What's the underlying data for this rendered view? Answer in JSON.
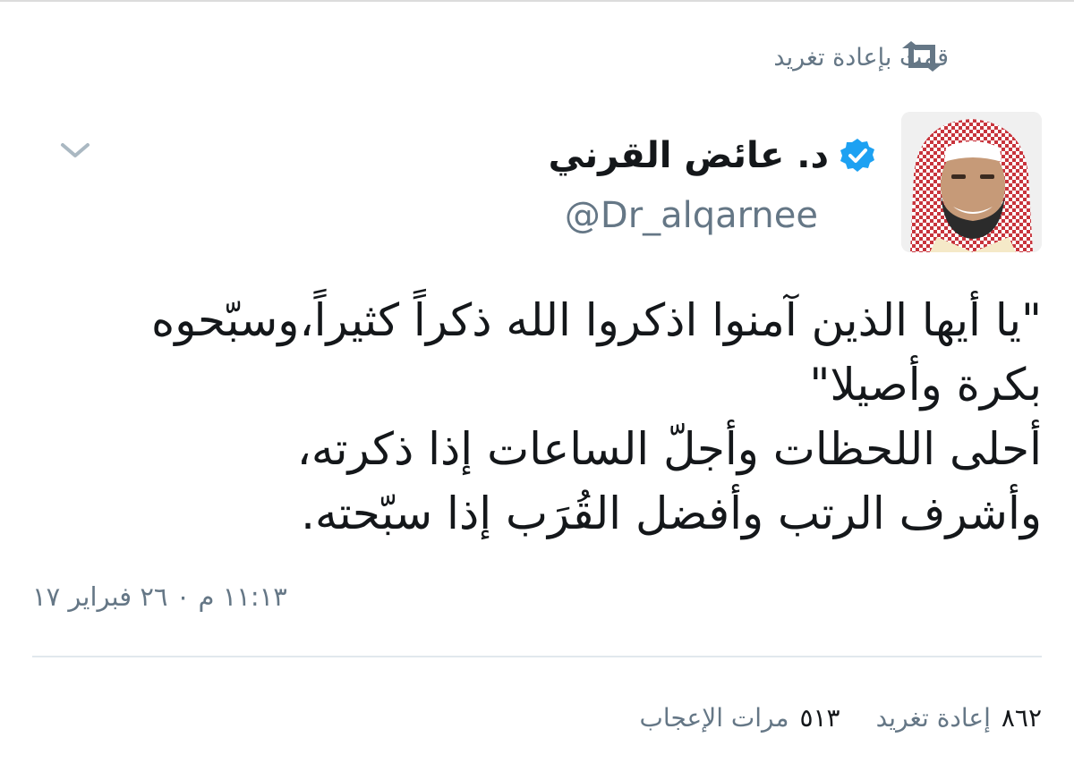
{
  "retweet_context": {
    "label": "قمت بإعادة تغريد",
    "icon": "retweet-icon"
  },
  "author": {
    "name": "د. عائض القرني",
    "handle": "@Dr_alqarnee",
    "verified": true,
    "verified_color": "#1da1f2"
  },
  "tweet": {
    "lines": [
      "\"يا أيها الذين آمنوا اذكروا الله ذكراً كثيراً،وسبّحوه",
      "بكرة وأصيلا\"",
      "أحلى اللحظات وأجلّ الساعات إذا ذكرته،",
      "وأشرف الرتب وأفضل القُرَب إذا سبّحته."
    ],
    "timestamp": "١١:١٣ م ٠ ٢٦ فبراير ١٧"
  },
  "stats": {
    "retweets_count": "٨٦٢",
    "retweets_label": "إعادة تغريد",
    "likes_count": "٥١٣",
    "likes_label": "مرات الإعجاب"
  },
  "colors": {
    "secondary_text": "#657786",
    "primary_text": "#14171a",
    "divider": "#e1e8ed"
  }
}
